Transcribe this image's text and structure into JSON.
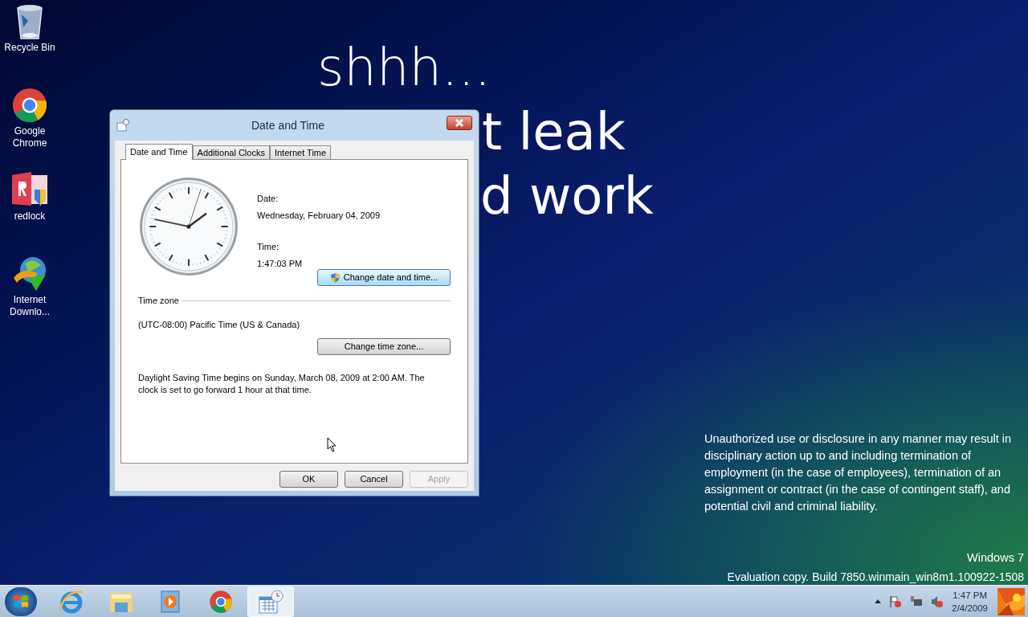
{
  "desktop_icons": [
    {
      "kind": "recycle",
      "label": "Recycle Bin"
    },
    {
      "kind": "chrome",
      "label": "Google Chrome"
    },
    {
      "kind": "redlock",
      "label": "redlock"
    },
    {
      "kind": "idm",
      "label": "Internet Downlo..."
    }
  ],
  "wallpaper": {
    "lines": [
      "shhh...",
      "t leak",
      "d work"
    ],
    "notice": "Unauthorized use or disclosure in any manner may result in disciplinary action up to and including termination of employment (in the case of employees), termination of an assignment or contract (in the case of contingent staff), and potential civil and criminal liability.",
    "os_name": "Windows 7",
    "build": "Evaluation copy. Build 7850.winmain_win8m1.100922-1508"
  },
  "dialog": {
    "title": "Date and Time",
    "tabs": [
      {
        "label": "Date and Time",
        "selected": true
      },
      {
        "label": "Additional Clocks",
        "selected": false
      },
      {
        "label": "Internet Time",
        "selected": false
      }
    ],
    "date_label": "Date:",
    "date_value": "Wednesday, February 04, 2009",
    "time_label": "Time:",
    "time_value": "1:47:03 PM",
    "change_datetime_button": "Change date and time...",
    "timezone_heading": "Time zone",
    "timezone_value": "(UTC-08:00) Pacific Time (US & Canada)",
    "change_timezone_button": "Change time zone...",
    "dst_note": "Daylight Saving Time begins on Sunday, March 08, 2009 at 2:00 AM. The clock is set to go forward 1 hour at that time.",
    "buttons": [
      {
        "label": "OK",
        "disabled": false
      },
      {
        "label": "Cancel",
        "disabled": false
      },
      {
        "label": "Apply",
        "disabled": true
      }
    ]
  },
  "taskbar": {
    "items": [
      {
        "kind": "ie",
        "selected": false
      },
      {
        "kind": "explorer",
        "selected": false
      },
      {
        "kind": "media",
        "selected": false
      },
      {
        "kind": "chrome",
        "selected": false
      },
      {
        "kind": "datetime",
        "selected": true
      }
    ],
    "clock_time": "1:47 PM",
    "clock_date": "2/4/2009"
  }
}
